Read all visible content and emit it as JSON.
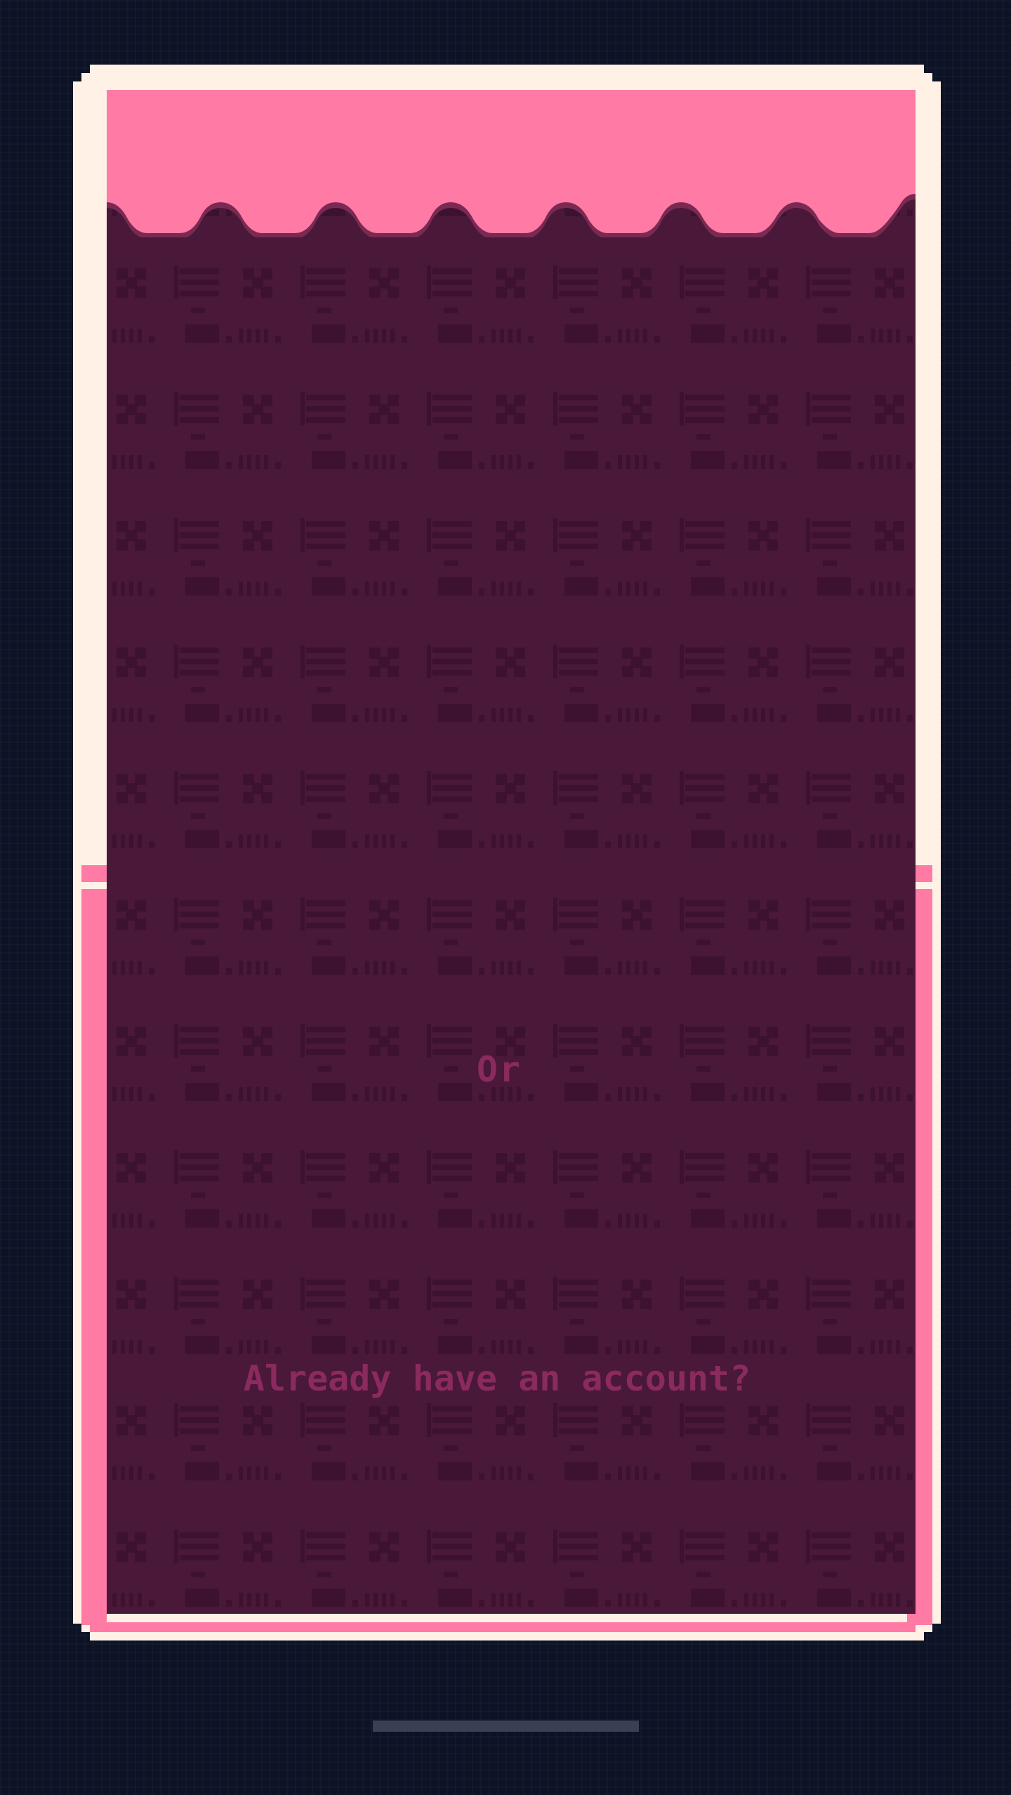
{
  "app": {
    "divider_text": "Or",
    "login_prompt": "Already have an account?"
  },
  "colors": {
    "background": "#0d1326",
    "frame_cream": "#fff1e6",
    "accent_pink": "#ff7aa5",
    "screen_maroon": "#4a1838",
    "pattern_dark": "#3d1230",
    "text_muted": "#8a2a5e",
    "home_indicator": "#3b3f56"
  }
}
